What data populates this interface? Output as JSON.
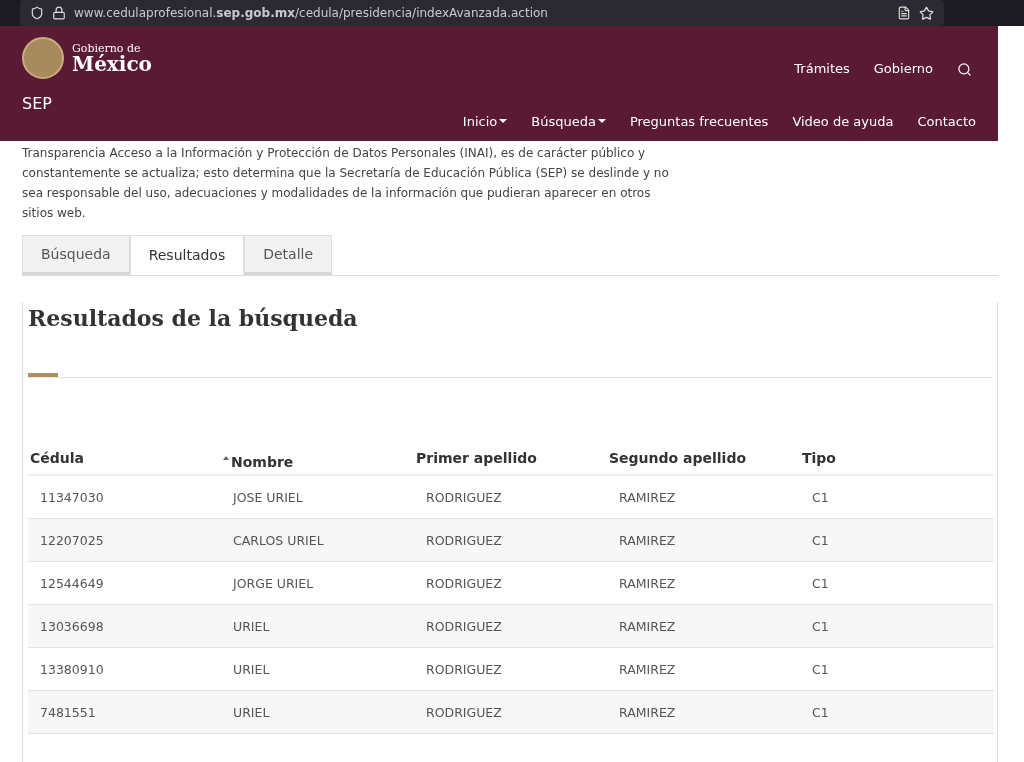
{
  "browser": {
    "url": "www.cedulaprofesional.**sep.gob.mx**/cedula/presidencia/indexAvanzada.action"
  },
  "header": {
    "logo_line_1": "Gobierno de",
    "logo_line_2": "México",
    "top_links": [
      "Trámites",
      "Gobierno"
    ],
    "site": "SEP",
    "nav": [
      {
        "label": "Inicio",
        "dropdown": true
      },
      {
        "label": "Búsqueda",
        "dropdown": true
      },
      {
        "label": "Preguntas frecuentes",
        "dropdown": false
      },
      {
        "label": "Video de ayuda",
        "dropdown": false
      },
      {
        "label": "Contacto",
        "dropdown": false
      }
    ]
  },
  "notice": "Transparencia  Acceso a la Información y Protección de Datos Personales (INAI), es de carácter público y constantemente se actualiza; esto determina que la Secretaría de Educación Pública (SEP) se deslinde y no sea responsable del uso, adecuaciones y modalidades de la información que pudieran aparecer en otros sitios web.",
  "tabs": [
    {
      "label": "Búsqueda",
      "selected": false
    },
    {
      "label": "Resultados",
      "selected": true
    },
    {
      "label": "Detalle",
      "selected": false
    }
  ],
  "results": {
    "title": "Resultados de la búsqueda",
    "columns": [
      {
        "label": "Cédula",
        "sorted": false
      },
      {
        "label": "Nombre",
        "sorted": true
      },
      {
        "label": "Primer apellido",
        "sorted": false
      },
      {
        "label": "Segundo apellido",
        "sorted": false
      },
      {
        "label": "Tipo",
        "sorted": false
      }
    ],
    "rows": [
      [
        "11347030",
        "JOSE URIEL",
        "RODRIGUEZ",
        "RAMIREZ",
        "C1"
      ],
      [
        "12207025",
        "CARLOS URIEL",
        "RODRIGUEZ",
        "RAMIREZ",
        "C1"
      ],
      [
        "12544649",
        "JORGE URIEL",
        "RODRIGUEZ",
        "RAMIREZ",
        "C1"
      ],
      [
        "13036698",
        "URIEL",
        "RODRIGUEZ",
        "RAMIREZ",
        "C1"
      ],
      [
        "13380910",
        "URIEL",
        "RODRIGUEZ",
        "RAMIREZ",
        "C1"
      ],
      [
        "7481551",
        "URIEL",
        "RODRIGUEZ",
        "RAMIREZ",
        "C1"
      ]
    ]
  }
}
